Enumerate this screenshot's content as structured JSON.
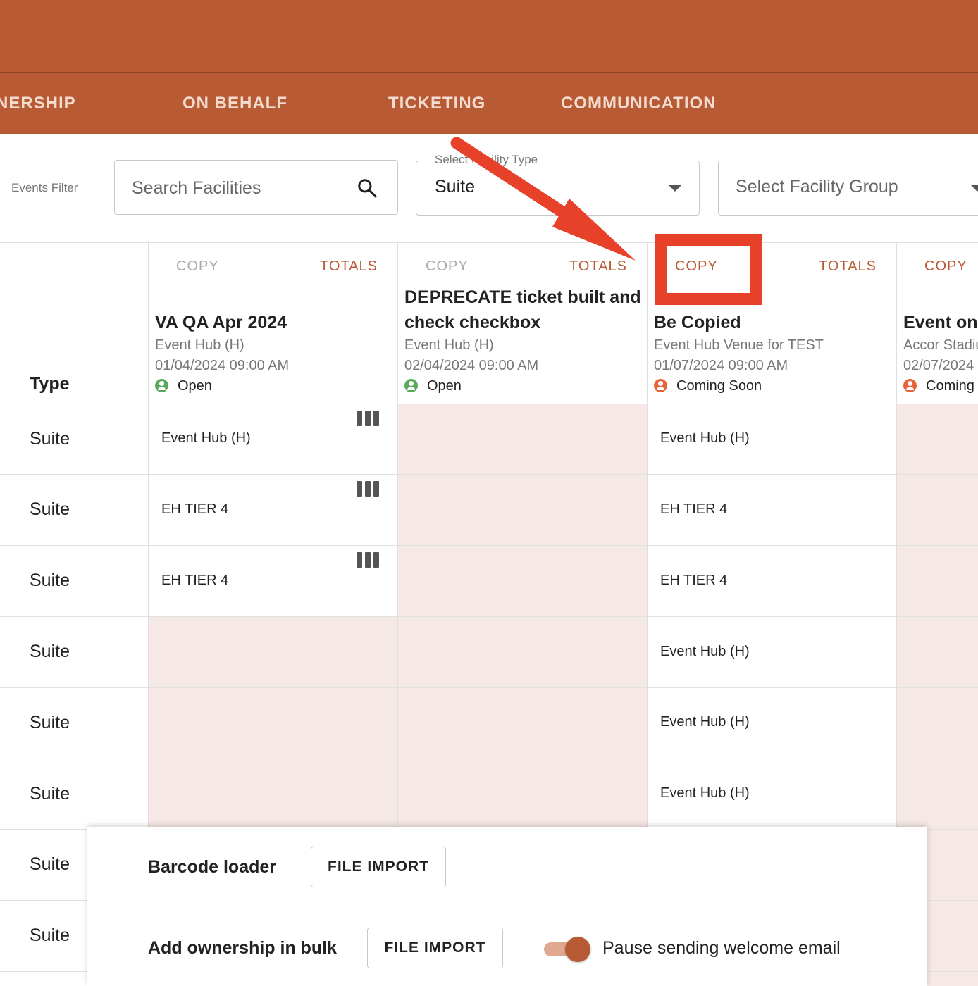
{
  "tabs": [
    "NERSHIP",
    "ON BEHALF",
    "TICKETING",
    "COMMUNICATION"
  ],
  "filters": {
    "events_filter_label": "Events Filter",
    "search_placeholder": "Search Facilities",
    "facility_type_label": "Select Facility Type",
    "facility_type_value": "Suite",
    "facility_group_placeholder": "Select Facility Group"
  },
  "table": {
    "type_header": "Type",
    "copy_label": "COPY",
    "totals_label": "TOTALS",
    "events": [
      {
        "title": "VA QA Apr 2024",
        "venue": "Event Hub (H)",
        "date": "01/04/2024 09:00 AM",
        "status": "Open"
      },
      {
        "title_line1": "DEPRECATE ticket built and",
        "title_line2": "check checkbox",
        "venue": "Event Hub (H)",
        "date": "02/04/2024 09:00 AM",
        "status": "Open"
      },
      {
        "title": "Be Copied",
        "venue": "Event Hub Venue for TEST",
        "date": "01/07/2024 09:00 AM",
        "status": "Coming Soon"
      },
      {
        "title": "Event on",
        "venue": "Accor Stadium",
        "date": "02/07/2024",
        "status": "Coming"
      }
    ],
    "rows": [
      {
        "type": "Suite",
        "c1": "Event Hub (H)",
        "c3": "Event Hub (H)"
      },
      {
        "type": "Suite",
        "c1": "EH TIER 4",
        "c3": "EH TIER 4"
      },
      {
        "type": "Suite",
        "c1": "EH TIER 4",
        "c3": "EH TIER 4"
      },
      {
        "type": "Suite",
        "c3": "Event Hub (H)"
      },
      {
        "type": "Suite",
        "c3": "Event Hub (H)"
      },
      {
        "type": "Suite",
        "c3": "Event Hub (H)"
      },
      {
        "type": "Suite"
      },
      {
        "type": "Suite"
      }
    ]
  },
  "bulk_panel": {
    "barcode_label": "Barcode loader",
    "bulk_label": "Add ownership in bulk",
    "import_label": "FILE IMPORT",
    "toggle_label": "Pause sending welcome email",
    "toggle_on": true
  },
  "colors": {
    "brand": "#b85a33",
    "annotation": "#e8412a",
    "empty_cell": "#f6e8e5"
  }
}
